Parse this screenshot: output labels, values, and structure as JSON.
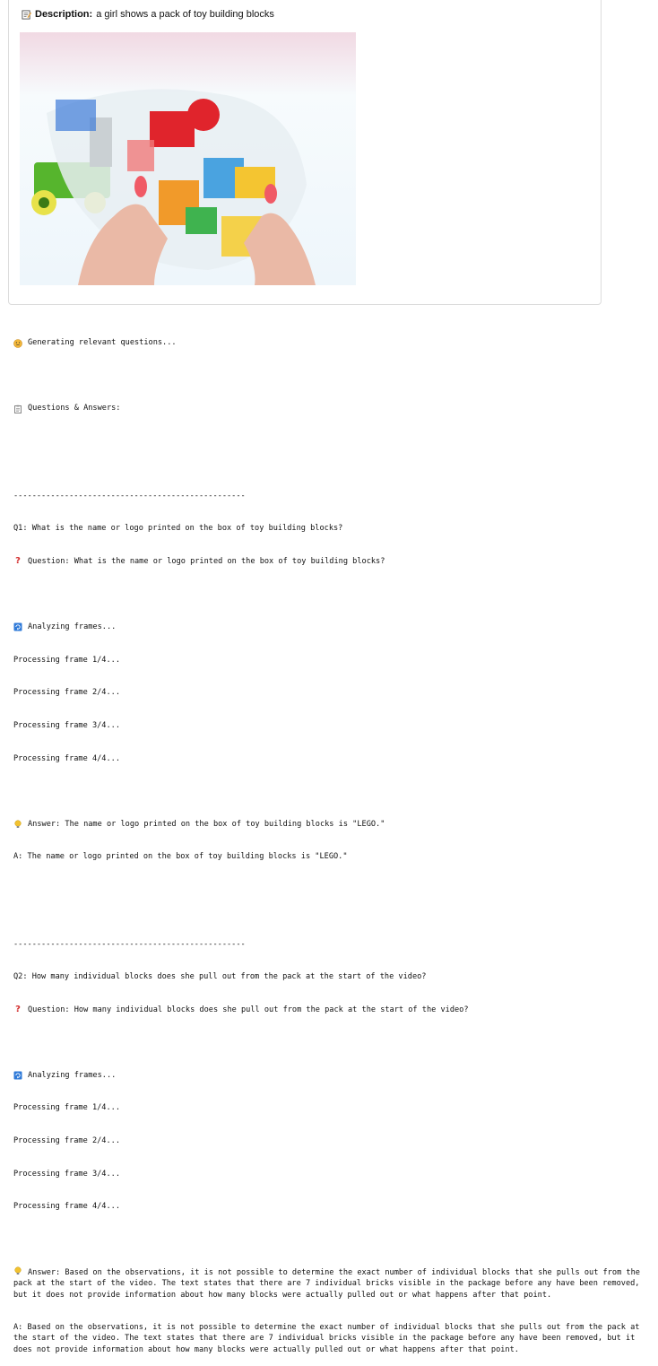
{
  "description": {
    "label": "Description:",
    "text": "a girl shows a pack of toy building blocks"
  },
  "log": {
    "generating": "Generating relevant questions...",
    "qa_header": "Questions & Answers:",
    "separator": "--------------------------------------------------",
    "q1": {
      "line": "Q1: What is the name or logo printed on the box of toy building blocks?",
      "question": "Question: What is the name or logo printed on the box of toy building blocks?",
      "analyzing": "Analyzing frames...",
      "frames": [
        "Processing frame 1/4...",
        "Processing frame 2/4...",
        "Processing frame 3/4...",
        "Processing frame 4/4..."
      ],
      "answer": "Answer: The name or logo printed on the box of toy building blocks is \"LEGO.\"",
      "a_line": "A: The name or logo printed on the box of toy building blocks is \"LEGO.\""
    },
    "q2": {
      "line": "Q2: How many individual blocks does she pull out from the pack at the start of the video?",
      "question": "Question: How many individual blocks does she pull out from the pack at the start of the video?",
      "analyzing": "Analyzing frames...",
      "frames": [
        "Processing frame 1/4...",
        "Processing frame 2/4...",
        "Processing frame 3/4...",
        "Processing frame 4/4..."
      ],
      "answer": "Answer: Based on the observations, it is not possible to determine the exact number of individual blocks that she pulls out from the pack at the start of the video. The text states that there are 7 individual bricks visible in the package before any have been removed, but it does not provide information about how many blocks were actually pulled out or what happens after that point.",
      "a_line": "A: Based on the observations, it is not possible to determine the exact number of individual blocks that she pulls out from the pack at the start of the video. The text states that there are 7 individual bricks visible in the package before any have been removed, but it does not provide information about how many blocks were actually pulled out or what happens after that point."
    }
  },
  "icons": {
    "description": "memo-icon",
    "generating": "thinking-face-icon",
    "qa_header": "clipboard-icon",
    "question": "red-question-mark-icon",
    "analyzing": "arrows-cycle-icon",
    "answer": "light-bulb-icon"
  },
  "colors": {
    "question_mark": "#d32f2f",
    "analyzing_icon": "#2f7ad8",
    "bulb": "#f2c230",
    "thinking": "#f5b93a"
  }
}
